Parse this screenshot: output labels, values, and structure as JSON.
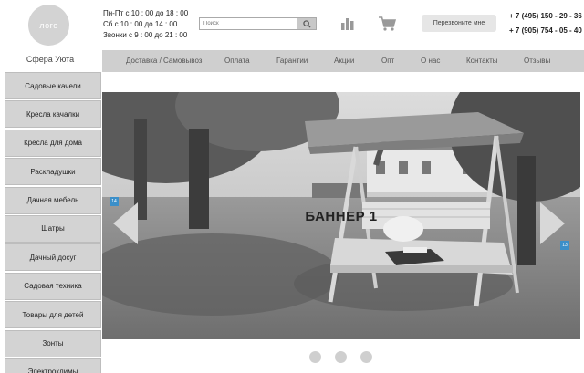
{
  "logo": {
    "text": "лого"
  },
  "brand": {
    "name": "Сфера   Уюта"
  },
  "hours": [
    "Пн-Пт с 10 : 00 до 18 : 00",
    "Сб с 10 : 00 до 14 : 00",
    "Звонки с 9 : 00 до 21 : 00"
  ],
  "search": {
    "placeholder": "Поиск",
    "icon": "search-icon"
  },
  "header_icons": {
    "chart": "bar-chart-icon",
    "cart": "cart-icon"
  },
  "callback": {
    "label": "Перезвоните мне"
  },
  "phones": [
    "+ 7 (495) 150 - 29 - 36",
    "+ 7 (905) 754 - 05 - 40"
  ],
  "topnav": [
    "Доставка / Самовывоз",
    "Оплата",
    "Гарантии",
    "Акции",
    "Опт",
    "О нас",
    "Контакты",
    "Отзывы"
  ],
  "sidebar": [
    "Садовые качели",
    "Кресла качалки",
    "Кресла для дома",
    "Раскладушки",
    "Дачная мебель",
    "Шатры",
    "Дачный досуг",
    "Садовая техника",
    "Товары для детей",
    "Зонты",
    "Электроклимы"
  ],
  "banner": {
    "title": "БАННЕР 1",
    "badge_left": "14",
    "badge_right": "13",
    "slides": 3
  },
  "colors": {
    "nav_bg": "#cfcfcf",
    "sidebar_bg": "#d3d3d3",
    "badge": "#3b8fc9"
  }
}
